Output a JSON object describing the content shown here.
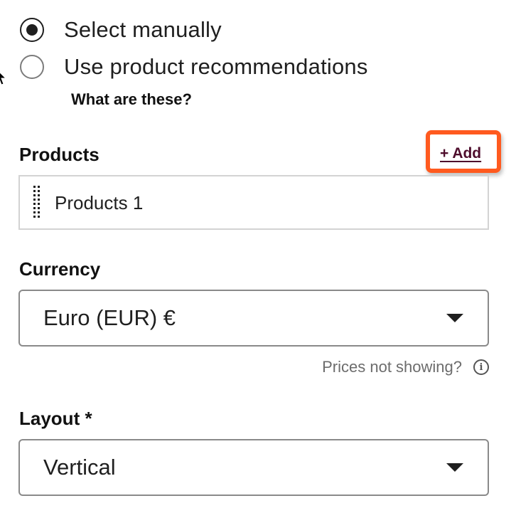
{
  "recommendation_source": {
    "options": [
      {
        "label": "Select manually",
        "selected": true
      },
      {
        "label": "Use product recommendations",
        "selected": false
      }
    ],
    "help_link": "What are these?"
  },
  "products": {
    "heading": "Products",
    "add_label": "+ Add",
    "items": [
      {
        "label": "Products 1"
      }
    ]
  },
  "currency": {
    "heading": "Currency",
    "value": "Euro (EUR) €",
    "help_text": "Prices not showing?",
    "info_icon": "i"
  },
  "layout": {
    "heading": "Layout *",
    "value": "Vertical"
  },
  "colors": {
    "highlight": "#ff5a1f",
    "link": "#4e0d2c",
    "text": "#1f1f1f",
    "muted_text": "#6c6c6c"
  }
}
